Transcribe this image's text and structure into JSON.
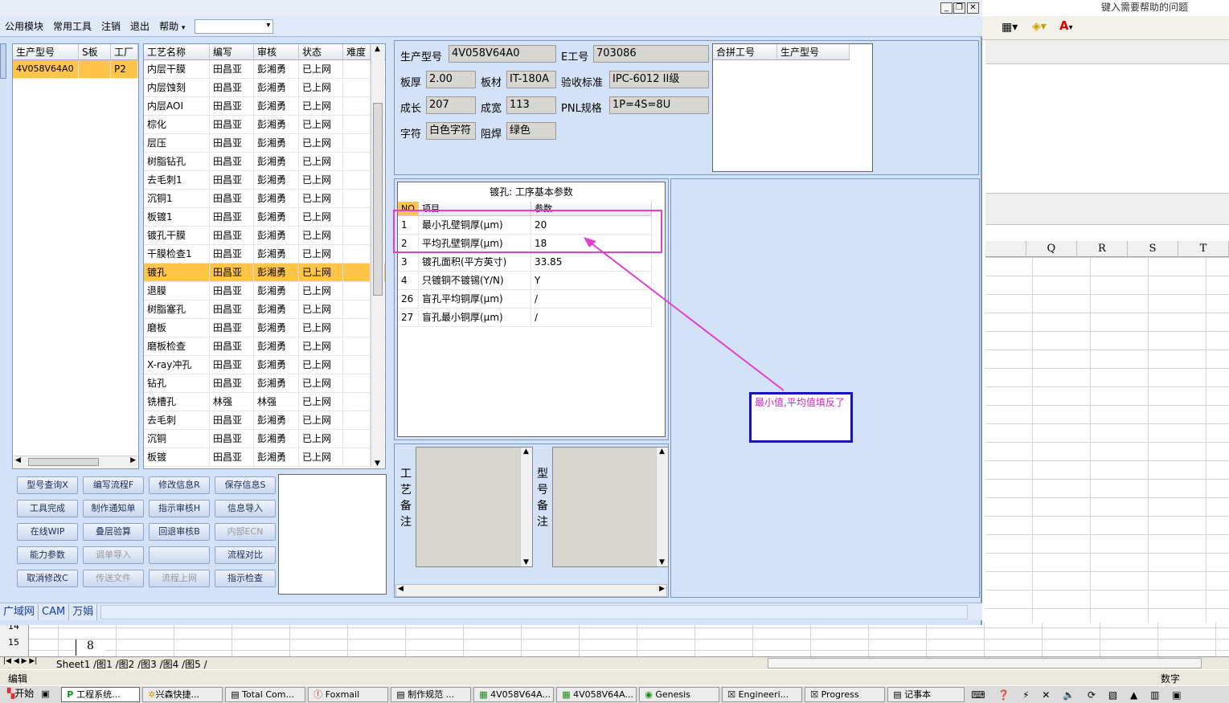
{
  "excel": {
    "help_text": "键入需要帮助的问题",
    "columns": [
      "Q",
      "R",
      "S",
      "T"
    ],
    "row_numbers": [
      "14",
      "15"
    ],
    "cell_value": "8",
    "sheet_tabs": "Sheet1 /图1 /图2 /图3 /图4 /图5 /",
    "status_left": "编辑",
    "status_right": "数字"
  },
  "menu": {
    "items": [
      "公用模块",
      "常用工具",
      "注销",
      "退出",
      "帮助"
    ]
  },
  "model_list": {
    "headers": [
      "生产型号",
      "S板",
      "工厂"
    ],
    "rows": [
      [
        "4V058V64A0",
        "",
        "P2"
      ]
    ]
  },
  "process_list": {
    "headers": [
      "工艺名称",
      "编写",
      "审核",
      "状态",
      "难度"
    ],
    "rows": [
      [
        "内层干膜",
        "田昌亚",
        "彭湘勇",
        "已上网"
      ],
      [
        "内层蚀刻",
        "田昌亚",
        "彭湘勇",
        "已上网"
      ],
      [
        "内层AOI",
        "田昌亚",
        "彭湘勇",
        "已上网"
      ],
      [
        "棕化",
        "田昌亚",
        "彭湘勇",
        "已上网"
      ],
      [
        "层压",
        "田昌亚",
        "彭湘勇",
        "已上网"
      ],
      [
        "树脂钻孔",
        "田昌亚",
        "彭湘勇",
        "已上网"
      ],
      [
        "去毛刺1",
        "田昌亚",
        "彭湘勇",
        "已上网"
      ],
      [
        "沉铜1",
        "田昌亚",
        "彭湘勇",
        "已上网"
      ],
      [
        "板镀1",
        "田昌亚",
        "彭湘勇",
        "已上网"
      ],
      [
        "镀孔干膜",
        "田昌亚",
        "彭湘勇",
        "已上网"
      ],
      [
        "干膜检查1",
        "田昌亚",
        "彭湘勇",
        "已上网"
      ],
      [
        "镀孔",
        "田昌亚",
        "彭湘勇",
        "已上网"
      ],
      [
        "退膜",
        "田昌亚",
        "彭湘勇",
        "已上网"
      ],
      [
        "树脂塞孔",
        "田昌亚",
        "彭湘勇",
        "已上网"
      ],
      [
        "磨板",
        "田昌亚",
        "彭湘勇",
        "已上网"
      ],
      [
        "磨板检查",
        "田昌亚",
        "彭湘勇",
        "已上网"
      ],
      [
        "X-ray冲孔",
        "田昌亚",
        "彭湘勇",
        "已上网"
      ],
      [
        "钻孔",
        "田昌亚",
        "彭湘勇",
        "已上网"
      ],
      [
        "铣槽孔",
        "林强",
        "林强",
        "已上网"
      ],
      [
        "去毛刺",
        "田昌亚",
        "彭湘勇",
        "已上网"
      ],
      [
        "沉铜",
        "田昌亚",
        "彭湘勇",
        "已上网"
      ],
      [
        "板镀",
        "田昌亚",
        "彭湘勇",
        "已上网"
      ]
    ]
  },
  "buttons": [
    {
      "label": "型号查询X",
      "enabled": true
    },
    {
      "label": "编写流程F",
      "enabled": true
    },
    {
      "label": "修改信息R",
      "enabled": true
    },
    {
      "label": "保存信息S",
      "enabled": true
    },
    {
      "label": "工具完成",
      "enabled": true
    },
    {
      "label": "制作通知单",
      "enabled": true
    },
    {
      "label": "指示审核H",
      "enabled": true
    },
    {
      "label": "信息导入",
      "enabled": true
    },
    {
      "label": "在线WIP",
      "enabled": true
    },
    {
      "label": "叠层验算",
      "enabled": true
    },
    {
      "label": "回退审核B",
      "enabled": true
    },
    {
      "label": "内部ECN",
      "enabled": false
    },
    {
      "label": "能力参数",
      "enabled": true
    },
    {
      "label": "调单导入",
      "enabled": false
    },
    {
      "label": "",
      "enabled": true
    },
    {
      "label": "流程对比",
      "enabled": true
    },
    {
      "label": "取消修改C",
      "enabled": true
    },
    {
      "label": "传送文件",
      "enabled": false
    },
    {
      "label": "流程上网",
      "enabled": false
    },
    {
      "label": "指示检查",
      "enabled": true
    }
  ],
  "info": {
    "model_label": "生产型号",
    "model_value": "4V058V64A0",
    "eng_label": "E工号",
    "eng_value": "703086",
    "thick_label": "板厚",
    "thick_value": "2.00",
    "mat_label": "板材",
    "mat_value": "IT-180A",
    "std_label": "验收标准",
    "std_value": "IPC-6012 II级",
    "len_label": "成长",
    "len_value": "207",
    "wid_label": "成宽",
    "wid_value": "113",
    "pnl_label": "PNL规格",
    "pnl_value": "1P=4S=8U",
    "char_label": "字符",
    "char_value": "白色字符",
    "mask_label": "阻焊",
    "mask_value": "绿色",
    "merge_headers": [
      "合拼工号",
      "生产型号"
    ]
  },
  "params": {
    "title": "镀孔: 工序基本参数",
    "headers": [
      "NO",
      "项目",
      "参数"
    ],
    "rows": [
      [
        "1",
        "最小孔壁铜厚(μm)",
        "20"
      ],
      [
        "2",
        "平均孔壁铜厚(μm)",
        "18"
      ],
      [
        "3",
        "镀孔面积(平方英寸)",
        "33.85"
      ],
      [
        "4",
        "只镀铜不镀锡(Y/N)",
        "Y"
      ],
      [
        "26",
        "盲孔平均铜厚(μm)",
        "/"
      ],
      [
        "27",
        "盲孔最小铜厚(μm)",
        "/"
      ]
    ]
  },
  "remarks": {
    "process_label": "工艺备注",
    "model_label": "型号备注"
  },
  "annotation": {
    "note": "最小值,平均值填反了",
    "color": "#e040d0",
    "box_color": "#1a14b8"
  },
  "bottom_tabs": [
    "广域网",
    "CAM",
    "万娟"
  ],
  "taskbar": [
    "开始",
    "工程系统...",
    "兴森快捷...",
    "Total Com...",
    "Foxmail",
    "制作规范 ...",
    "4V058V64A...",
    "4V058V64A...",
    "Genesis",
    "Engineeri...",
    "Progress",
    "记事本"
  ]
}
